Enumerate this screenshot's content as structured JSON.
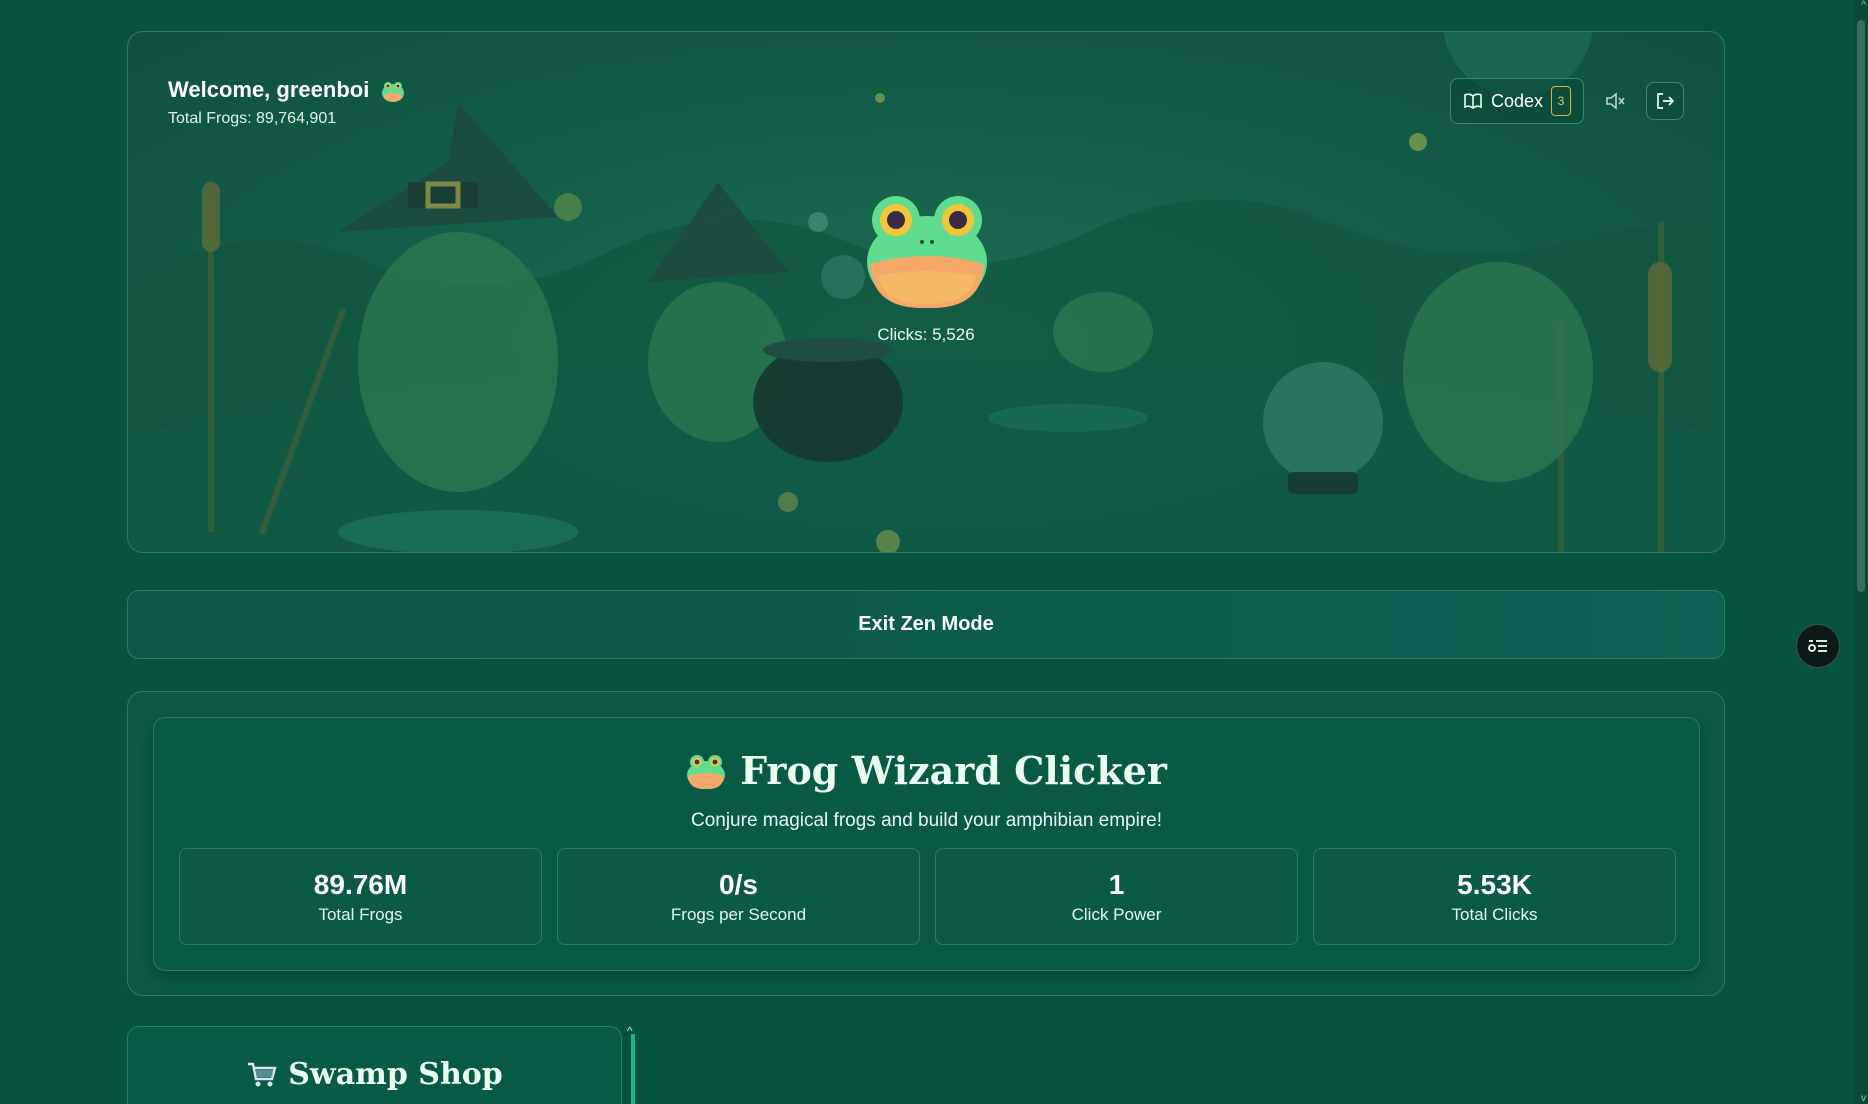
{
  "hero": {
    "welcome": "Welcome, greenboi",
    "total_frogs_line": "Total Frogs: 89,764,901",
    "clicks_line": "Clicks: 5,526",
    "codex_label": "Codex",
    "codex_badge": "3"
  },
  "zen": {
    "label": "Exit Zen Mode"
  },
  "game": {
    "title": "Frog Wizard Clicker",
    "subtitle": "Conjure magical frogs and build your amphibian empire!",
    "stats": [
      {
        "value": "89.76M",
        "label": "Total Frogs"
      },
      {
        "value": "0/s",
        "label": "Frogs per Second"
      },
      {
        "value": "1",
        "label": "Click Power"
      },
      {
        "value": "5.53K",
        "label": "Total Clicks"
      }
    ]
  },
  "shop": {
    "title": "Swamp Shop"
  },
  "icons": {
    "codex": "book-open-icon",
    "mute": "volume-mute-icon",
    "logout": "logout-icon",
    "fab": "menu-list-icon",
    "frog": "frog-emoji-icon",
    "cart": "shopping-cart-icon"
  },
  "colors": {
    "background": "#06533f",
    "accent": "#1fb58a",
    "badge": "#f1c64d"
  }
}
